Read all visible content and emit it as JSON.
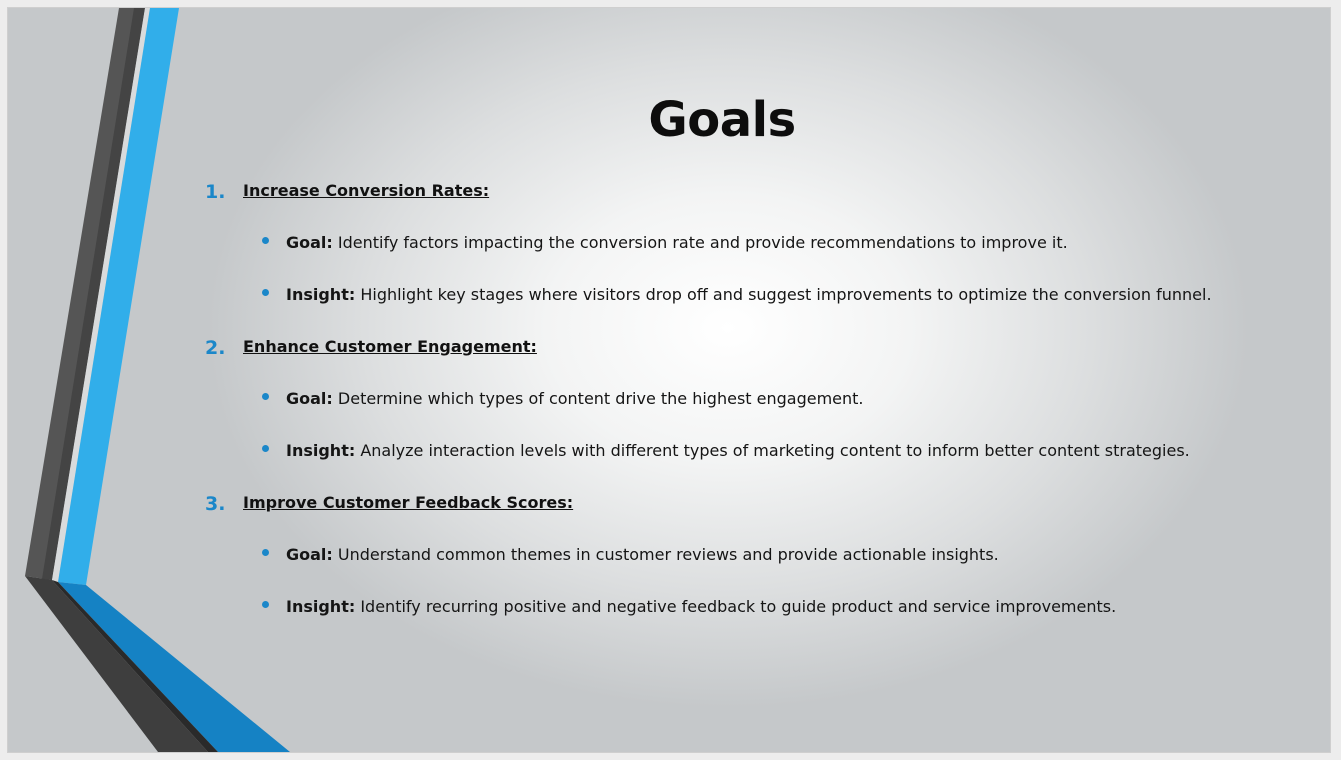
{
  "slide": {
    "title": "Goals",
    "sections": [
      {
        "number": "1.",
        "heading": "Increase Conversion Rates:",
        "bullets": [
          {
            "key": "Goal:",
            "text": " Identify factors impacting the conversion rate and provide recommendations to improve it."
          },
          {
            "key": "Insight:",
            "text": " Highlight key stages where visitors drop off and suggest improvements to optimize the conversion funnel."
          }
        ]
      },
      {
        "number": "2.",
        "heading": "Enhance Customer Engagement:",
        "bullets": [
          {
            "key": "Goal:",
            "text": " Determine which types of content drive the highest engagement."
          },
          {
            "key": "Insight:",
            "text": " Analyze interaction levels with different types of marketing content to inform better content strategies."
          }
        ]
      },
      {
        "number": "3.",
        "heading": "Improve Customer Feedback Scores:",
        "bullets": [
          {
            "key": "Goal:",
            "text": " Understand common themes in customer reviews and provide actionable insights."
          },
          {
            "key": "Insight:",
            "text": " Identify recurring positive and negative feedback to guide product and service improvements."
          }
        ]
      }
    ]
  },
  "colors": {
    "accent_blue": "#1b87c9",
    "stripe_light_blue": "#31aeea",
    "stripe_dark_gray": "#505050"
  }
}
